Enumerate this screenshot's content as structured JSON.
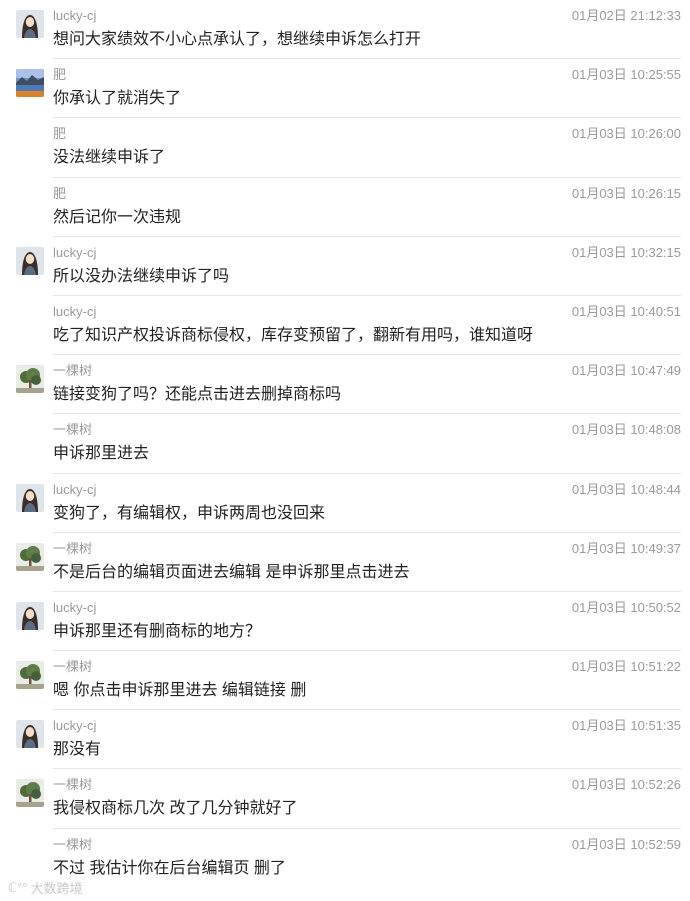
{
  "messages": [
    {
      "name": "lucky-cj",
      "time": "01月02日 21:12:33",
      "text": "想问大家绩效不小心点承认了，想继续申诉怎么打开",
      "avatar": "girl-avatar"
    },
    {
      "name": "肥",
      "time": "01月03日 10:25:55",
      "text": "你承认了就消失了",
      "avatar": "lake-avatar"
    },
    {
      "name": "肥",
      "time": "01月03日 10:26:00",
      "text": "没法继续申诉了",
      "avatar": ""
    },
    {
      "name": "肥",
      "time": "01月03日 10:26:15",
      "text": "然后记你一次违规",
      "avatar": ""
    },
    {
      "name": "lucky-cj",
      "time": "01月03日 10:32:15",
      "text": "所以没办法继续申诉了吗",
      "avatar": "girl-avatar"
    },
    {
      "name": "lucky-cj",
      "time": "01月03日 10:40:51",
      "text": "吃了知识产权投诉商标侵权，库存变预留了，翻新有用吗，谁知道呀",
      "avatar": ""
    },
    {
      "name": "一棵树",
      "time": "01月03日 10:47:49",
      "text": "链接变狗了吗？还能点击进去删掉商标吗",
      "avatar": "tree-avatar"
    },
    {
      "name": "一棵树",
      "time": "01月03日 10:48:08",
      "text": "申诉那里进去",
      "avatar": ""
    },
    {
      "name": "lucky-cj",
      "time": "01月03日 10:48:44",
      "text": "变狗了，有编辑权，申诉两周也没回来",
      "avatar": "girl-avatar"
    },
    {
      "name": "一棵树",
      "time": "01月03日 10:49:37",
      "text": "不是后台的编辑页面进去编辑  是申诉那里点击进去",
      "avatar": "tree-avatar"
    },
    {
      "name": "lucky-cj",
      "time": "01月03日 10:50:52",
      "text": "申诉那里还有删商标的地方？",
      "avatar": "girl-avatar"
    },
    {
      "name": "一棵树",
      "time": "01月03日 10:51:22",
      "text": "嗯  你点击申诉那里进去  编辑链接  删",
      "avatar": "tree-avatar"
    },
    {
      "name": "lucky-cj",
      "time": "01月03日 10:51:35",
      "text": "那没有",
      "avatar": "girl-avatar"
    },
    {
      "name": "一棵树",
      "time": "01月03日 10:52:26",
      "text": "我侵权商标几次 改了几分钟就好了",
      "avatar": "tree-avatar"
    },
    {
      "name": "一棵树",
      "time": "01月03日 10:52:59",
      "text": "不过 我估计你在后台编辑页 删了",
      "avatar": ""
    }
  ],
  "watermark": {
    "logo": "ℂ°°",
    "text": "大数跨境"
  }
}
